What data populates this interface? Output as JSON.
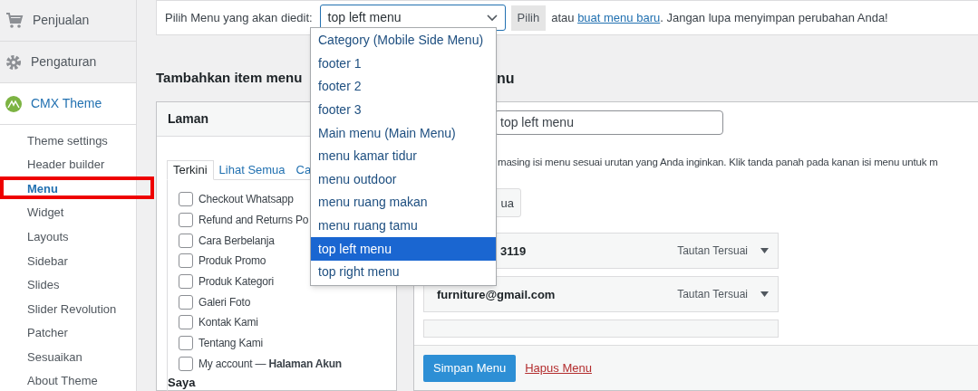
{
  "sidebar": {
    "items": [
      {
        "label": "Penjualan",
        "current": false
      },
      {
        "label": "Pengaturan",
        "current": false
      },
      {
        "label": "CMX Theme",
        "current": true
      }
    ],
    "submenu": [
      {
        "label": "Theme settings",
        "selected": false
      },
      {
        "label": "Header builder",
        "selected": false
      },
      {
        "label": "Menu",
        "selected": true
      },
      {
        "label": "Widget",
        "selected": false
      },
      {
        "label": "Layouts",
        "selected": false
      },
      {
        "label": "Sidebar",
        "selected": false
      },
      {
        "label": "Slides",
        "selected": false
      },
      {
        "label": "Slider Revolution",
        "selected": false
      },
      {
        "label": "Patcher",
        "selected": false
      },
      {
        "label": "Sesuaikan",
        "selected": false
      },
      {
        "label": "About Theme",
        "selected": false
      }
    ]
  },
  "select_bar": {
    "label": "Pilih Menu yang akan diedit:",
    "value": "top left menu",
    "button": "Pilih",
    "note_before": "atau",
    "link": "buat menu baru",
    "note_after": ". Jangan lupa menyimpan perubahan Anda!"
  },
  "dropdown": {
    "options": [
      {
        "label": "Category (Mobile Side Menu)",
        "selected": false
      },
      {
        "label": "footer 1",
        "selected": false
      },
      {
        "label": "footer 2",
        "selected": false
      },
      {
        "label": "footer 3",
        "selected": false
      },
      {
        "label": "Main menu (Main Menu)",
        "selected": false
      },
      {
        "label": "menu kamar tidur",
        "selected": false
      },
      {
        "label": "menu outdoor",
        "selected": false
      },
      {
        "label": "menu ruang makan",
        "selected": false
      },
      {
        "label": "menu ruang tamu",
        "selected": false
      },
      {
        "label": "top left menu",
        "selected": true
      },
      {
        "label": "top right menu",
        "selected": false
      }
    ]
  },
  "add_items": {
    "heading": "Tambahkan item menu",
    "panel_title": "Laman",
    "tabs": [
      {
        "label": "Terkini",
        "selected": true
      },
      {
        "label": "Lihat Semua",
        "selected": false
      },
      {
        "label": "Ca",
        "selected": false
      }
    ],
    "pages": [
      {
        "label": "Checkout Whatsapp",
        "checked": false
      },
      {
        "label": "Refund and Returns Po",
        "checked": false
      },
      {
        "label": "Cara Berbelanja",
        "checked": false
      },
      {
        "label": "Produk Promo",
        "checked": false
      },
      {
        "label": "Produk Kategori",
        "checked": false
      },
      {
        "label": "Galeri Foto",
        "checked": false
      },
      {
        "label": "Kontak Kami",
        "checked": false
      },
      {
        "label": "Tentang Kami",
        "checked": false
      },
      {
        "label": "My account — **Halaman Akun**",
        "checked": false
      }
    ],
    "trailing_text": "Saya"
  },
  "structure": {
    "heading": "nu",
    "menu_name": "top left menu",
    "instruction": "masing isi menu sesuai urutan yang Anda inginkan. Klik tanda panah pada kanan isi menu untuk m",
    "button": "ua",
    "items": [
      {
        "title": "3119",
        "type": "Tautan Tersuai"
      },
      {
        "title": "furniture@gmail.com",
        "type": "Tautan Tersuai"
      }
    ],
    "save": "Simpan Menu",
    "delete": "Hapus Menu"
  }
}
